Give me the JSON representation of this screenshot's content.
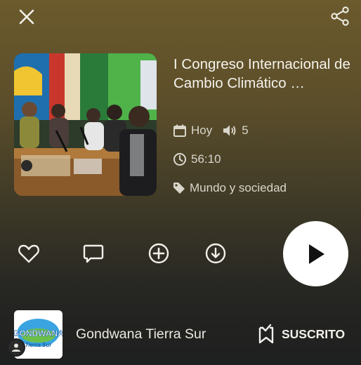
{
  "episode": {
    "title": "I Congreso Internacional de Cambio Climático …",
    "date": "Hoy",
    "plays": "5",
    "duration": "56:10",
    "category": "Mundo y sociedad"
  },
  "channel": {
    "name": "Gondwana Tierra Sur",
    "logo_text": "GONDWANA",
    "logo_subtext": "Tierra Sur",
    "subscribe_label": "SUSCRITO"
  },
  "icons": {
    "close": "close-icon",
    "share": "share-icon",
    "calendar": "calendar-icon",
    "volume": "volume-icon",
    "clock": "clock-icon",
    "tag": "tag-icon",
    "like": "heart-icon",
    "comment": "comment-icon",
    "add": "plus-circle-icon",
    "download": "download-icon",
    "play": "play-icon",
    "subscribed": "bookmark-check-icon",
    "avatar": "user-icon"
  },
  "colors": {
    "play_button": "#ffffff",
    "text_primary": "#f5f3ed",
    "text_secondary": "#d9d6cc"
  }
}
